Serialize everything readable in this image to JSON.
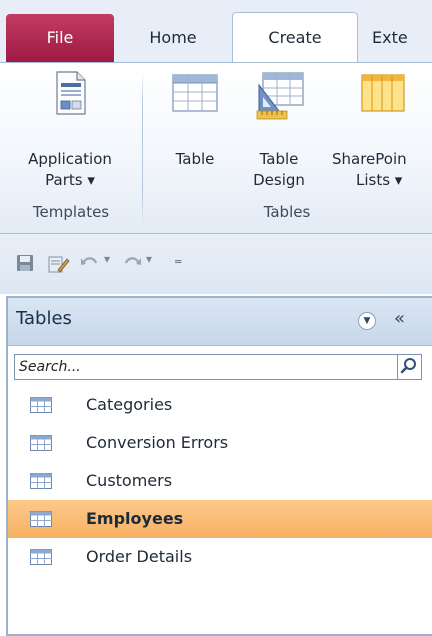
{
  "tabs": {
    "file": "File",
    "home": "Home",
    "create": "Create",
    "external": "Exte"
  },
  "ribbon": {
    "app_parts": {
      "line1": "Application",
      "line2": "Parts ▾"
    },
    "table": {
      "label": "Table"
    },
    "table_design": {
      "line1": "Table",
      "line2": "Design"
    },
    "sharepoint": {
      "line1": "SharePoin",
      "line2": "Lists ▾"
    },
    "groups": {
      "templates": "Templates",
      "tables": "Tables"
    }
  },
  "nav": {
    "title": "Tables",
    "search_placeholder": "Search...",
    "items": [
      {
        "label": "Categories"
      },
      {
        "label": "Conversion Errors"
      },
      {
        "label": "Customers"
      },
      {
        "label": "Employees"
      },
      {
        "label": "Order Details"
      }
    ],
    "selected_index": 3
  },
  "colors": {
    "file_tab": "#b02a55",
    "selection": "#f7b063",
    "accent_border": "#9cb1cc"
  }
}
